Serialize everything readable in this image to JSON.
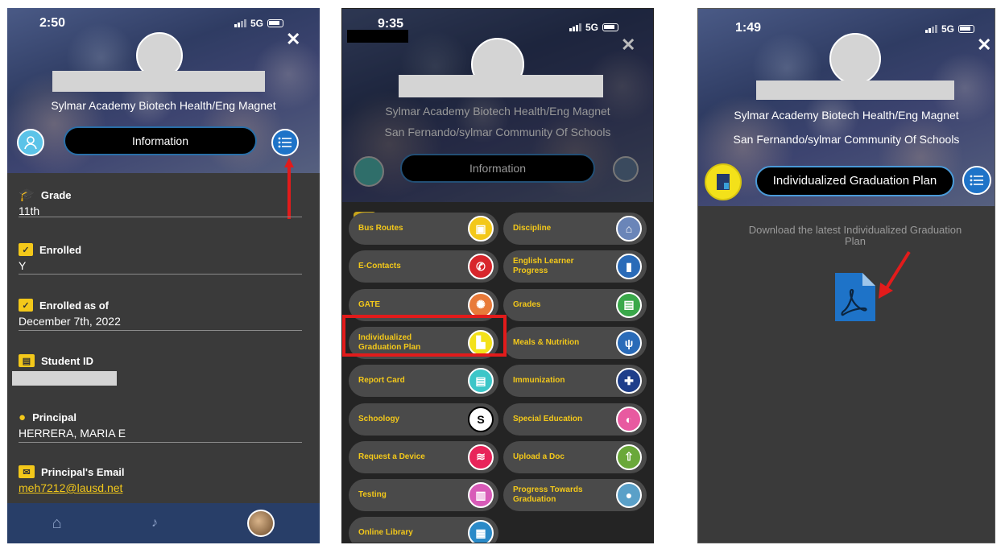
{
  "p1": {
    "time": "2:50",
    "network": "5G",
    "close": "✕",
    "school_line1": "Sylmar Academy Biotech Health/Eng Magnet",
    "info_pill": "Information",
    "fields": [
      {
        "label": "Grade",
        "value": "11th"
      },
      {
        "label": "Enrolled",
        "value": "Y"
      },
      {
        "label": "Enrolled as of",
        "value": "December 7th, 2022"
      },
      {
        "label": "Student ID",
        "value": ""
      },
      {
        "label": "Principal",
        "value": "HERRERA, MARIA E"
      },
      {
        "label": "Principal's Email",
        "value": "meh7212@lausd.net"
      }
    ],
    "colors": {
      "accent": "#f3c81a",
      "email": "#f3c81a",
      "arrow": "#e21b1b",
      "nav": "#283e68"
    }
  },
  "p2": {
    "time": "9:35",
    "network": "5G",
    "close": "✕",
    "school_line1": "Sylmar Academy Biotech Health/Eng Magnet",
    "school_line2": "San Fernando/sylmar Community Of Schools",
    "info_pill": "Information",
    "menu": [
      {
        "label": "Bus Routes",
        "icon": "bus-icon"
      },
      {
        "label": "Discipline",
        "icon": "home-icon"
      },
      {
        "label": "E-Contacts",
        "icon": "phone-icon"
      },
      {
        "label": "English Learner Progress",
        "icon": "book-icon"
      },
      {
        "label": "GATE",
        "icon": "brain-icon"
      },
      {
        "label": "Grades",
        "icon": "grades-icon"
      },
      {
        "label": "Individualized Graduation Plan",
        "icon": "document-icon"
      },
      {
        "label": "Meals & Nutrition",
        "icon": "utensils-icon"
      },
      {
        "label": "Report Card",
        "icon": "report-icon"
      },
      {
        "label": "Immunization",
        "icon": "medical-icon"
      },
      {
        "label": "Schoology",
        "icon": "schoology-icon"
      },
      {
        "label": "Special Education",
        "icon": "special-ed-icon"
      },
      {
        "label": "Request a Device",
        "icon": "wifi-icon"
      },
      {
        "label": "Upload a Doc",
        "icon": "upload-icon"
      },
      {
        "label": "Testing",
        "icon": "testing-icon"
      },
      {
        "label": "Progress Towards Graduation",
        "icon": "graduate-icon"
      },
      {
        "label": "Online Library",
        "icon": "library-icon"
      }
    ]
  },
  "p3": {
    "time": "1:49",
    "network": "5G",
    "close": "✕",
    "school_line1": "Sylmar Academy Biotech Health/Eng Magnet",
    "school_line2": "San Fernando/sylmar Community Of Schools",
    "igp_pill": "Individualized Graduation Plan",
    "download_text": "Download the latest Individualized Graduation Plan",
    "pdf_icon": "pdf-icon"
  }
}
